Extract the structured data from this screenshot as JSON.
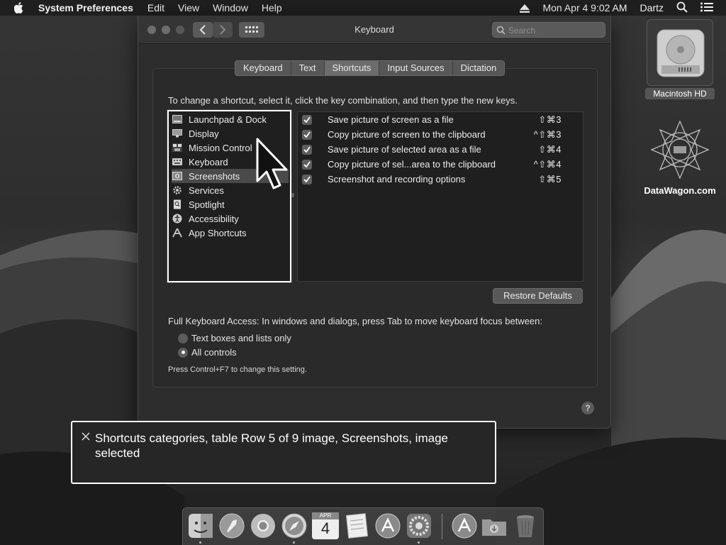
{
  "menubar": {
    "app_name": "System Preferences",
    "menus": [
      "Edit",
      "View",
      "Window",
      "Help"
    ],
    "datetime": "Mon Apr 4  9:02 AM",
    "user": "Dartz"
  },
  "window": {
    "title": "Keyboard",
    "search_placeholder": "Search",
    "tabs": [
      {
        "label": "Keyboard",
        "active": false
      },
      {
        "label": "Text",
        "active": false
      },
      {
        "label": "Shortcuts",
        "active": true
      },
      {
        "label": "Input Sources",
        "active": false
      },
      {
        "label": "Dictation",
        "active": false
      }
    ],
    "instructions": "To change a shortcut, select it, click the key combination, and then type the new keys.",
    "categories": [
      {
        "label": "Launchpad & Dock",
        "icon": "launchpad-icon",
        "selected": false
      },
      {
        "label": "Display",
        "icon": "display-icon",
        "selected": false
      },
      {
        "label": "Mission Control",
        "icon": "mission-control-icon",
        "selected": false
      },
      {
        "label": "Keyboard",
        "icon": "keyboard-icon",
        "selected": false
      },
      {
        "label": "Screenshots",
        "icon": "screenshot-icon",
        "selected": true
      },
      {
        "label": "Services",
        "icon": "gear-icon",
        "selected": false
      },
      {
        "label": "Spotlight",
        "icon": "spotlight-icon",
        "selected": false
      },
      {
        "label": "Accessibility",
        "icon": "accessibility-icon",
        "selected": false
      },
      {
        "label": "App Shortcuts",
        "icon": "app-shortcuts-icon",
        "selected": false
      }
    ],
    "shortcuts": [
      {
        "label": "Save picture of screen as a file",
        "keys": "⇧⌘3",
        "checked": true
      },
      {
        "label": "Copy picture of screen to the clipboard",
        "keys": "^⇧⌘3",
        "checked": true
      },
      {
        "label": "Save picture of selected area as a file",
        "keys": "⇧⌘4",
        "checked": true
      },
      {
        "label": "Copy picture of sel...area to the clipboard",
        "keys": "^⇧⌘4",
        "checked": true
      },
      {
        "label": "Screenshot and recording options",
        "keys": "⇧⌘5",
        "checked": true
      }
    ],
    "restore_label": "Restore Defaults",
    "full_keyboard_access": "Full Keyboard Access: In windows and dialogs, press Tab to move keyboard focus between:",
    "radio_options": [
      {
        "label": "Text boxes and lists only",
        "selected": false
      },
      {
        "label": "All controls",
        "selected": true
      }
    ],
    "hint": "Press Control+F7 to change this setting.",
    "help": "?"
  },
  "voiceover": {
    "text": "Shortcuts categories, table Row 5 of 9 image, Screenshots, image selected"
  },
  "desktop": {
    "drive_label": "Macintosh HD",
    "site_label": "DataWagon.com",
    "calendar_month": "APR",
    "calendar_day": "4"
  },
  "dock": {
    "items": [
      "finder-icon",
      "launchpad-icon",
      "chrome-icon",
      "safari-icon",
      "calendar-icon",
      "notes-icon",
      "app-store-icon",
      "system-preferences-icon",
      "app-store-icon",
      "downloads-folder-icon",
      "trash-icon"
    ]
  }
}
